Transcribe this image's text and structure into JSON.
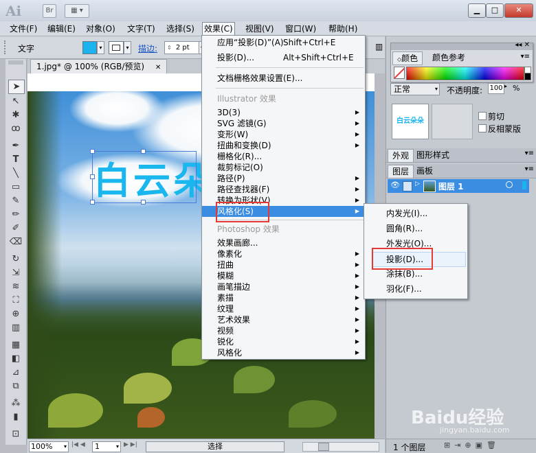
{
  "app": {
    "logo": "Ai",
    "bridge_btn": "Br"
  },
  "menubar": [
    {
      "label": "文件(F)"
    },
    {
      "label": "编辑(E)"
    },
    {
      "label": "对象(O)"
    },
    {
      "label": "文字(T)"
    },
    {
      "label": "选择(S)"
    },
    {
      "label": "效果(C)"
    },
    {
      "label": "视图(V)"
    },
    {
      "label": "窗口(W)"
    },
    {
      "label": "帮助(H)"
    }
  ],
  "controlbar": {
    "tool_name": "文字",
    "stroke_label": "描边:",
    "stroke_value": "2 pt"
  },
  "document": {
    "tab_title": "1.jpg* @ 100% (RGB/预览)",
    "canvas_text": "白云朵"
  },
  "effect_menu": {
    "apply": "应用“投影(D)”(A)",
    "apply_sc": "Shift+Ctrl+E",
    "last": "投影(D)...",
    "last_sc": "Alt+Shift+Ctrl+E",
    "raster_settings": "文档栅格效果设置(E)...",
    "illustrator_header": "Illustrator 效果",
    "illustrator_items": [
      "3D(3)",
      "SVG 滤镜(G)",
      "变形(W)",
      "扭曲和变换(D)",
      "栅格化(R)...",
      "裁剪标记(O)",
      "路径(P)",
      "路径查找器(F)",
      "转换为形状(V)",
      "风格化(S)"
    ],
    "photoshop_header": "Photoshop 效果",
    "photoshop_items": [
      "效果画廊...",
      "像素化",
      "扭曲",
      "模糊",
      "画笔描边",
      "素描",
      "纹理",
      "艺术效果",
      "视频",
      "锐化",
      "风格化"
    ]
  },
  "stylize_submenu": [
    "内发光(I)...",
    "圆角(R)...",
    "外发光(O)...",
    "投影(D)...",
    "涂抹(B)...",
    "羽化(F)..."
  ],
  "panels": {
    "color_tabs": [
      "颜色",
      "颜色参考"
    ],
    "transparency": {
      "mode": "正常",
      "opacity_label": "不透明度:",
      "opacity_value": "100",
      "unit": "%",
      "clip": "剪切",
      "invert_mask": "反相蒙版",
      "thumb_text": "白云朵朵"
    },
    "appearance_tabs": [
      "外观",
      "图形样式"
    ],
    "layers_tabs": [
      "图层",
      "画板"
    ],
    "layer_name": "图层 1",
    "layer_count": "1 个图层"
  },
  "statusbar": {
    "zoom": "100%",
    "page": "1",
    "mode": "选择"
  },
  "watermark": {
    "text": "Baidu经验",
    "sub": "jingyan.baidu.com"
  }
}
